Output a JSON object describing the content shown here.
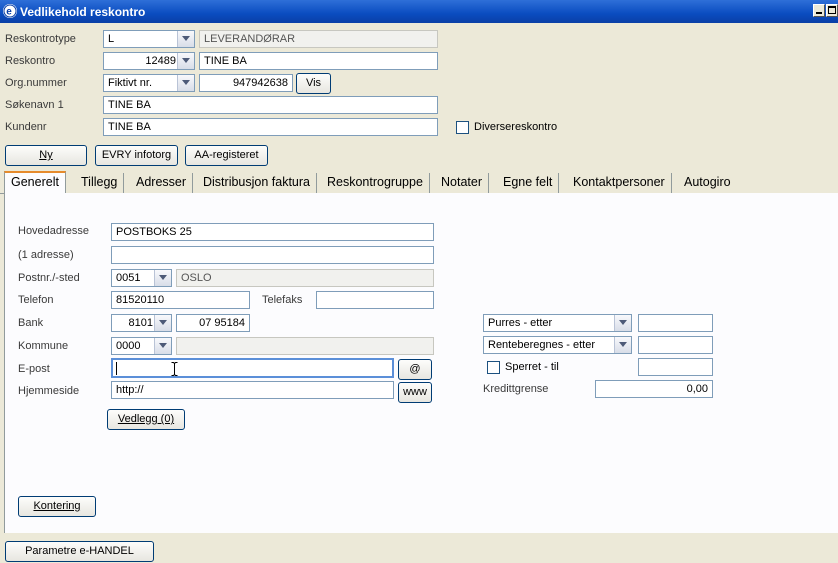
{
  "window": {
    "title": "Vedlikehold reskontro"
  },
  "header": {
    "reskontrotype": {
      "label": "Reskontrotype",
      "value": "L",
      "description": "LEVERANDØRAR"
    },
    "reskontro": {
      "label": "Reskontro",
      "value": "12489",
      "name": "TINE BA"
    },
    "orgnummer": {
      "label": "Org.nummer",
      "type_value": "Fiktivt nr.",
      "value": "947942638",
      "vis_button": "Vis"
    },
    "sokenavn": {
      "label": "Søkenavn 1",
      "value": "TINE BA"
    },
    "kundenr": {
      "label": "Kundenr",
      "value": "TINE BA"
    },
    "diverse_checkbox": {
      "label": "Diversereskontro",
      "checked": false
    }
  },
  "toolbar": {
    "ny": "Ny",
    "evry": "EVRY infotorg",
    "aa": "AA-registeret"
  },
  "tabs": [
    {
      "label": "Generelt",
      "active": true
    },
    {
      "label": "Tillegg"
    },
    {
      "label": "Adresser"
    },
    {
      "label": "Distribusjon faktura"
    },
    {
      "label": "Reskontrogruppe"
    },
    {
      "label": "Notater"
    },
    {
      "label": "Egne felt"
    },
    {
      "label": "Kontaktpersoner"
    },
    {
      "label": "Autogiro"
    }
  ],
  "general": {
    "hovedadresse": {
      "label": "Hovedadresse",
      "value": "POSTBOKS 25"
    },
    "adresse1": {
      "label": "(1 adresse)",
      "value": ""
    },
    "postnr": {
      "label": "Postnr./-sted",
      "value": "0051",
      "sted": "OSLO"
    },
    "telefon": {
      "label": "Telefon",
      "value": "81520110"
    },
    "telefaks": {
      "label": "Telefaks",
      "value": ""
    },
    "bank": {
      "label": "Bank",
      "value": "8101",
      "konto": "07 95184"
    },
    "kommune": {
      "label": "Kommune",
      "value": "0000",
      "name": ""
    },
    "epost": {
      "label": "E-post",
      "value": "",
      "at_button": "@"
    },
    "hjemmeside": {
      "label": "Hjemmeside",
      "value": "http://",
      "www_button": "www"
    },
    "vedlegg_button": "Vedlegg (0)",
    "purres": {
      "value": "Purres - etter",
      "field": ""
    },
    "renteberegnes": {
      "value": "Renteberegnes - etter",
      "field": ""
    },
    "sperret": {
      "label": "Sperret  -  til",
      "checked": false,
      "field": ""
    },
    "kredittgrense": {
      "label": "Kredittgrense",
      "value": "0,00"
    },
    "kontering_button": "Kontering"
  },
  "footer": {
    "parametre_button": "Parametre e-HANDEL"
  }
}
